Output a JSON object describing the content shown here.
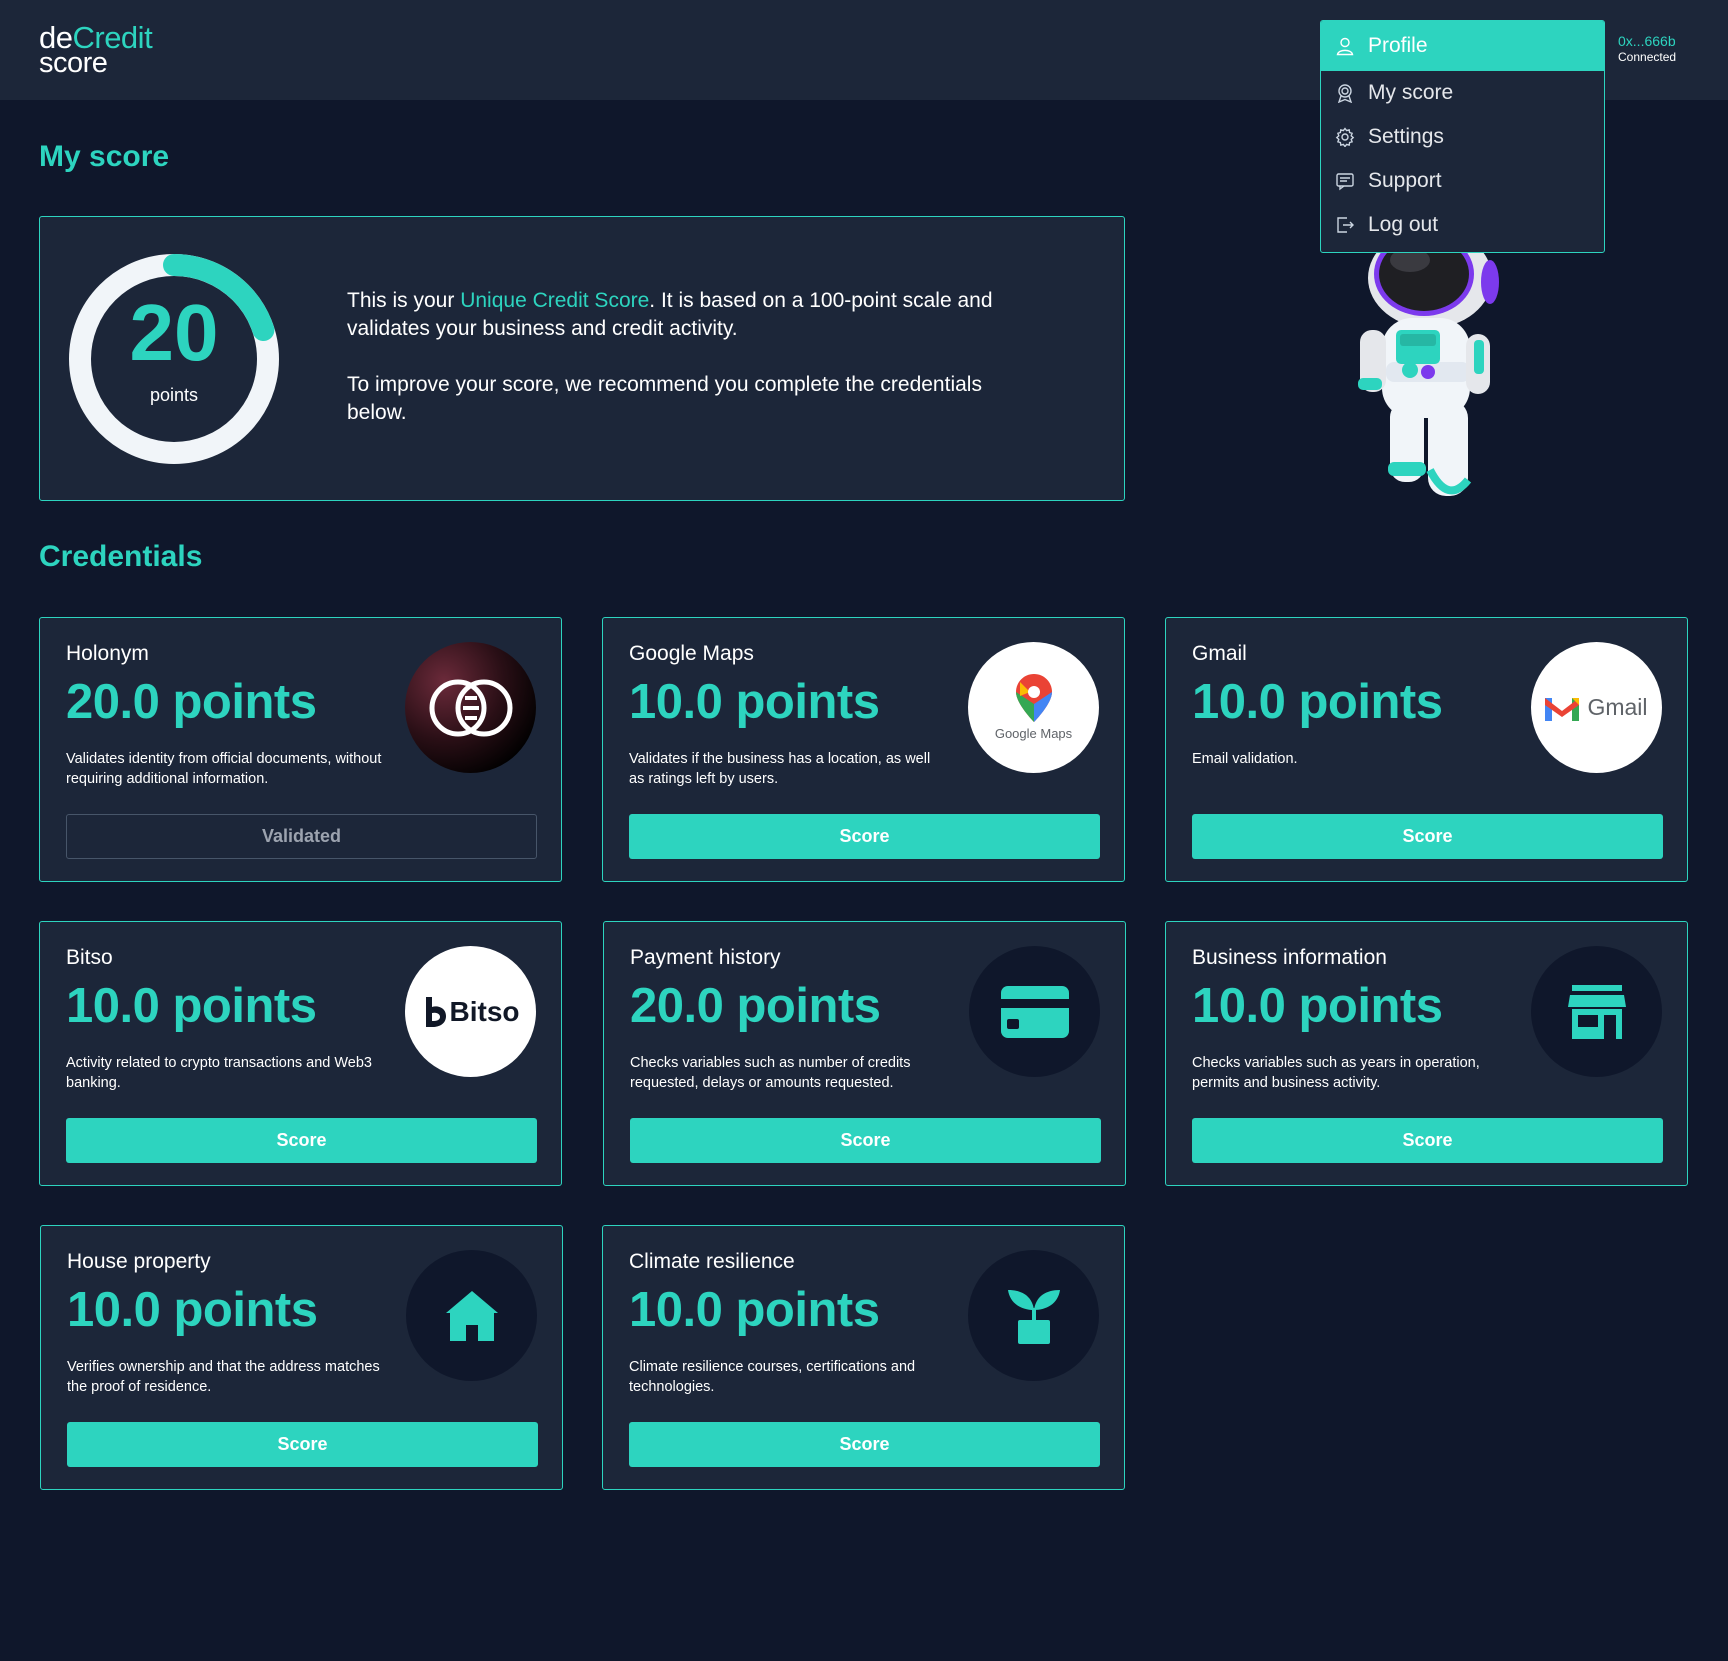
{
  "header": {
    "logo_top_de": "de",
    "logo_top_credit": "Credit",
    "logo_bottom": "score",
    "wallet_address": "0x...666b",
    "wallet_status": "Connected"
  },
  "menu": {
    "items": [
      {
        "label": "Profile",
        "icon": "user-icon",
        "active": true
      },
      {
        "label": "My score",
        "icon": "score-badge-icon",
        "active": false
      },
      {
        "label": "Settings",
        "icon": "gear-icon",
        "active": false
      },
      {
        "label": "Support",
        "icon": "chat-icon",
        "active": false
      },
      {
        "label": "Log out",
        "icon": "logout-icon",
        "active": false
      }
    ]
  },
  "page": {
    "title": "My score",
    "credentials_title": "Credentials"
  },
  "score": {
    "value": "20",
    "unit": "points",
    "max": 100,
    "text_pre": "This is your ",
    "text_highlight": "Unique Credit Score",
    "text_post": ". It is based on a 100-point scale and validates your business and credit activity.",
    "text_2": "To improve your score, we recommend you complete the credentials below."
  },
  "credentials": [
    {
      "name": "Holonym",
      "points": "20.0 points",
      "description": "Validates identity from official documents, without requiring additional information.",
      "button": "Validated",
      "logo": "holonym-logo"
    },
    {
      "name": "Google Maps",
      "points": "10.0 points",
      "description": "Validates if the business has a location, as well as ratings left by users.",
      "button": "Score",
      "logo": "google-maps-logo",
      "logo_text": "Google Maps"
    },
    {
      "name": "Gmail",
      "points": "10.0 points",
      "description": "Email validation.",
      "button": "Score",
      "logo": "gmail-logo",
      "logo_text": "Gmail"
    },
    {
      "name": "Bitso",
      "points": "10.0 points",
      "description": "Activity related to crypto transactions and Web3 banking.",
      "button": "Score",
      "logo": "bitso-logo",
      "logo_text": "Bitso"
    },
    {
      "name": "Payment history",
      "points": "20.0 points",
      "description": "Checks variables such as number of credits requested, delays or amounts requested.",
      "button": "Score",
      "logo": "credit-card-icon"
    },
    {
      "name": "Business information",
      "points": "10.0 points",
      "description": "Checks variables such as years in operation, permits and business activity.",
      "button": "Score",
      "logo": "storefront-icon"
    },
    {
      "name": "House property",
      "points": "10.0 points",
      "description": "Verifies ownership and that the address matches the proof of residence.",
      "button": "Score",
      "logo": "house-icon"
    },
    {
      "name": "Climate resilience",
      "points": "10.0 points",
      "description": "Climate resilience courses, certifications and technologies.",
      "button": "Score",
      "logo": "sprout-icon"
    }
  ],
  "colors": {
    "background": "#0f172b",
    "panel": "#1c2639",
    "accent": "#2dd4bf",
    "astronaut_accent": "#7c3aed"
  }
}
